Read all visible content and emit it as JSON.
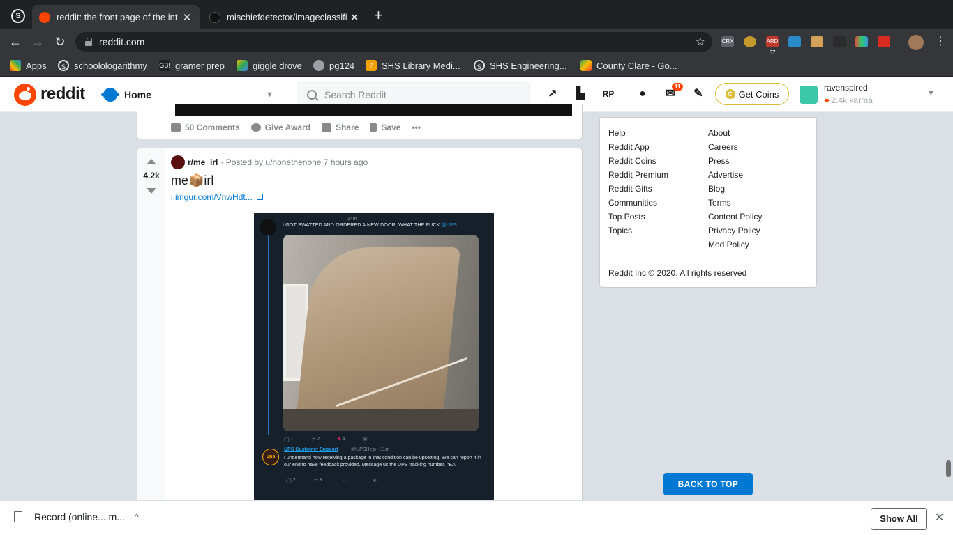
{
  "browser": {
    "tabs": [
      {
        "title": "reddit: the front page of the int",
        "close": "✕",
        "active": true
      },
      {
        "title": "mischiefdetector/imageclassifi",
        "close": "✕",
        "active": false
      }
    ],
    "new_tab": "+",
    "url": "reddit.com",
    "nav": {
      "back": "←",
      "forward": "→",
      "reload": "↻",
      "star": "☆"
    },
    "extensions": [
      "CRX",
      "ARD 67"
    ],
    "bookmarks": [
      {
        "label": "Apps"
      },
      {
        "label": "schoolologarithmy"
      },
      {
        "label": "gramer prep"
      },
      {
        "label": "giggle drove"
      },
      {
        "label": "pg124"
      },
      {
        "label": "SHS Library Medi..."
      },
      {
        "label": "SHS Engineering..."
      },
      {
        "label": "County Clare - Go..."
      }
    ]
  },
  "reddit_header": {
    "wordmark": "reddit",
    "feed_select": "Home",
    "search_placeholder": "Search Reddit",
    "mail_badge": "11",
    "get_coins": "Get Coins",
    "coin_glyph": "C",
    "username": "ravenspired",
    "karma": "2.4k karma"
  },
  "post_prev": {
    "comments": "50 Comments",
    "give_award": "Give Award",
    "share": "Share",
    "save": "Save",
    "more": "•••"
  },
  "post": {
    "score": "4.2k",
    "subreddit": "r/me_irl",
    "posted_by": "· Posted by u/nonethenone 7 hours ago",
    "title": "me📦irl",
    "link": "i.imgur.com/VnwHdt...",
    "tweet": {
      "time": "14m",
      "text": "I GOT SWATTED AND ORDERED A NEW DOOR, WHAT THE FUCK",
      "mention": "@UPS",
      "stats": [
        "1",
        "2",
        "4"
      ],
      "reply_name": "UPS Customer Support",
      "reply_handle": "@UPSHelp · 11m",
      "reply_text": "I understand how receiving a package in that condition can be upsetting. We can report it in our end to have feedback provided. Message us the UPS tracking number. ^EA",
      "reply_stats": [
        "2",
        "3"
      ],
      "ups_logo": "ups"
    }
  },
  "sidebar": {
    "col1": [
      "Help",
      "Reddit App",
      "Reddit Coins",
      "Reddit Premium",
      "Reddit Gifts",
      "Communities",
      "Top Posts",
      "Topics"
    ],
    "col2": [
      "About",
      "Careers",
      "Press",
      "Advertise",
      "Blog",
      "Terms",
      "Content Policy",
      "Privacy Policy",
      "Mod Policy"
    ],
    "copyright": "Reddit Inc © 2020. All rights reserved",
    "back_to_top": "BACK TO TOP"
  },
  "download_bar": {
    "file": "Record (online....m...",
    "chevron": "^",
    "show_all": "Show All",
    "close": "✕"
  }
}
